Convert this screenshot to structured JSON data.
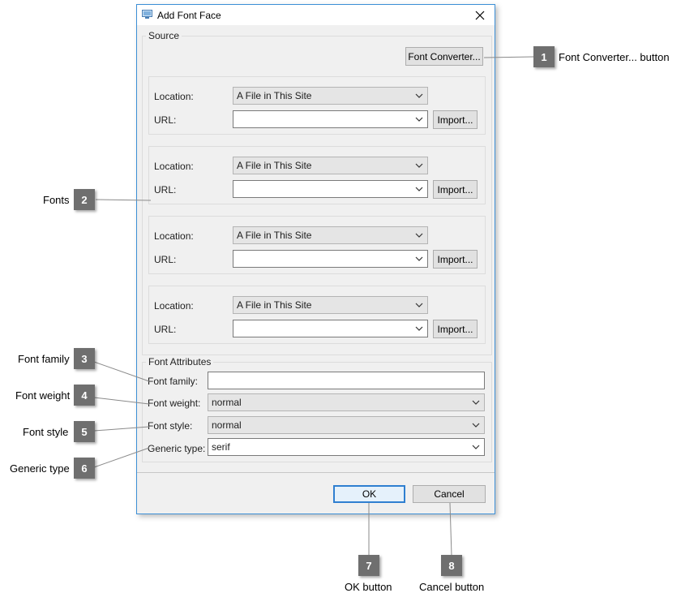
{
  "dialog": {
    "title": "Add Font Face",
    "source_group_label": "Source",
    "font_converter_button": "Font Converter...",
    "sources": [
      {
        "location_label": "Location:",
        "location_value": "A File in This Site",
        "url_label": "URL:",
        "url_value": "",
        "import_button": "Import..."
      },
      {
        "location_label": "Location:",
        "location_value": "A File in This Site",
        "url_label": "URL:",
        "url_value": "",
        "import_button": "Import..."
      },
      {
        "location_label": "Location:",
        "location_value": "A File in This Site",
        "url_label": "URL:",
        "url_value": "",
        "import_button": "Import..."
      },
      {
        "location_label": "Location:",
        "location_value": "A File in This Site",
        "url_label": "URL:",
        "url_value": "",
        "import_button": "Import..."
      }
    ],
    "attributes_group_label": "Font Attributes",
    "font_family_label": "Font family:",
    "font_family_value": "",
    "font_weight_label": "Font weight:",
    "font_weight_value": "normal",
    "font_style_label": "Font style:",
    "font_style_value": "normal",
    "generic_type_label": "Generic type:",
    "generic_type_value": "serif",
    "ok_button": "OK",
    "cancel_button": "Cancel"
  },
  "callouts": [
    {
      "number": "1",
      "text": "Font Converter... button"
    },
    {
      "number": "2",
      "text": "Fonts"
    },
    {
      "number": "3",
      "text": "Font family"
    },
    {
      "number": "4",
      "text": "Font weight"
    },
    {
      "number": "5",
      "text": "Font style"
    },
    {
      "number": "6",
      "text": "Generic type"
    },
    {
      "number": "7",
      "text": "OK button"
    },
    {
      "number": "8",
      "text": "Cancel button"
    }
  ],
  "colors": {
    "dialog_border": "#3c8fd6",
    "callout_badge": "#6f6f6f",
    "default_button_border": "#2f7fd0"
  }
}
